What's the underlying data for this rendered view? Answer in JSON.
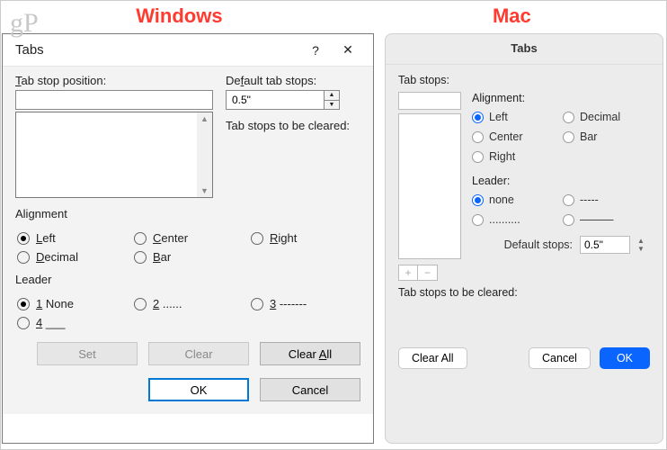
{
  "watermark": "gP",
  "headers": {
    "windows": "Windows",
    "mac": "Mac"
  },
  "windows": {
    "title": "Tabs",
    "help_icon": "?",
    "close_icon": "✕",
    "tab_stop_position_label": "Tab stop position:",
    "tab_stop_position_value": "",
    "default_tab_stops_label": "Default tab stops:",
    "default_tab_stops_value": "0.5\"",
    "to_be_cleared_label": "Tab stops to be cleared:",
    "alignment_label": "Alignment",
    "alignment_options": {
      "left": "Left",
      "center": "Center",
      "right": "Right",
      "decimal": "Decimal",
      "bar": "Bar"
    },
    "alignment_selected": "left",
    "leader_label": "Leader",
    "leader_options": {
      "none": "1 None",
      "dots": "2 ......",
      "dashes": "3 -------",
      "under": "4 ___"
    },
    "leader_selected": "none",
    "buttons": {
      "set": "Set",
      "clear": "Clear",
      "clear_all": "Clear All",
      "ok": "OK",
      "cancel": "Cancel"
    }
  },
  "mac": {
    "title": "Tabs",
    "tab_stops_label": "Tab stops:",
    "tab_stop_value": "",
    "alignment_label": "Alignment:",
    "alignment_options": {
      "left": "Left",
      "decimal": "Decimal",
      "center": "Center",
      "bar": "Bar",
      "right": "Right"
    },
    "alignment_selected": "left",
    "leader_label": "Leader:",
    "leader_options": {
      "none": "none",
      "dashes": "-----",
      "dots": "..........",
      "under": "———"
    },
    "leader_selected": "none",
    "default_stops_label": "Default stops:",
    "default_stops_value": "0.5\"",
    "to_be_cleared_label": "Tab stops to be cleared:",
    "buttons": {
      "clear_all": "Clear All",
      "cancel": "Cancel",
      "ok": "OK"
    }
  }
}
